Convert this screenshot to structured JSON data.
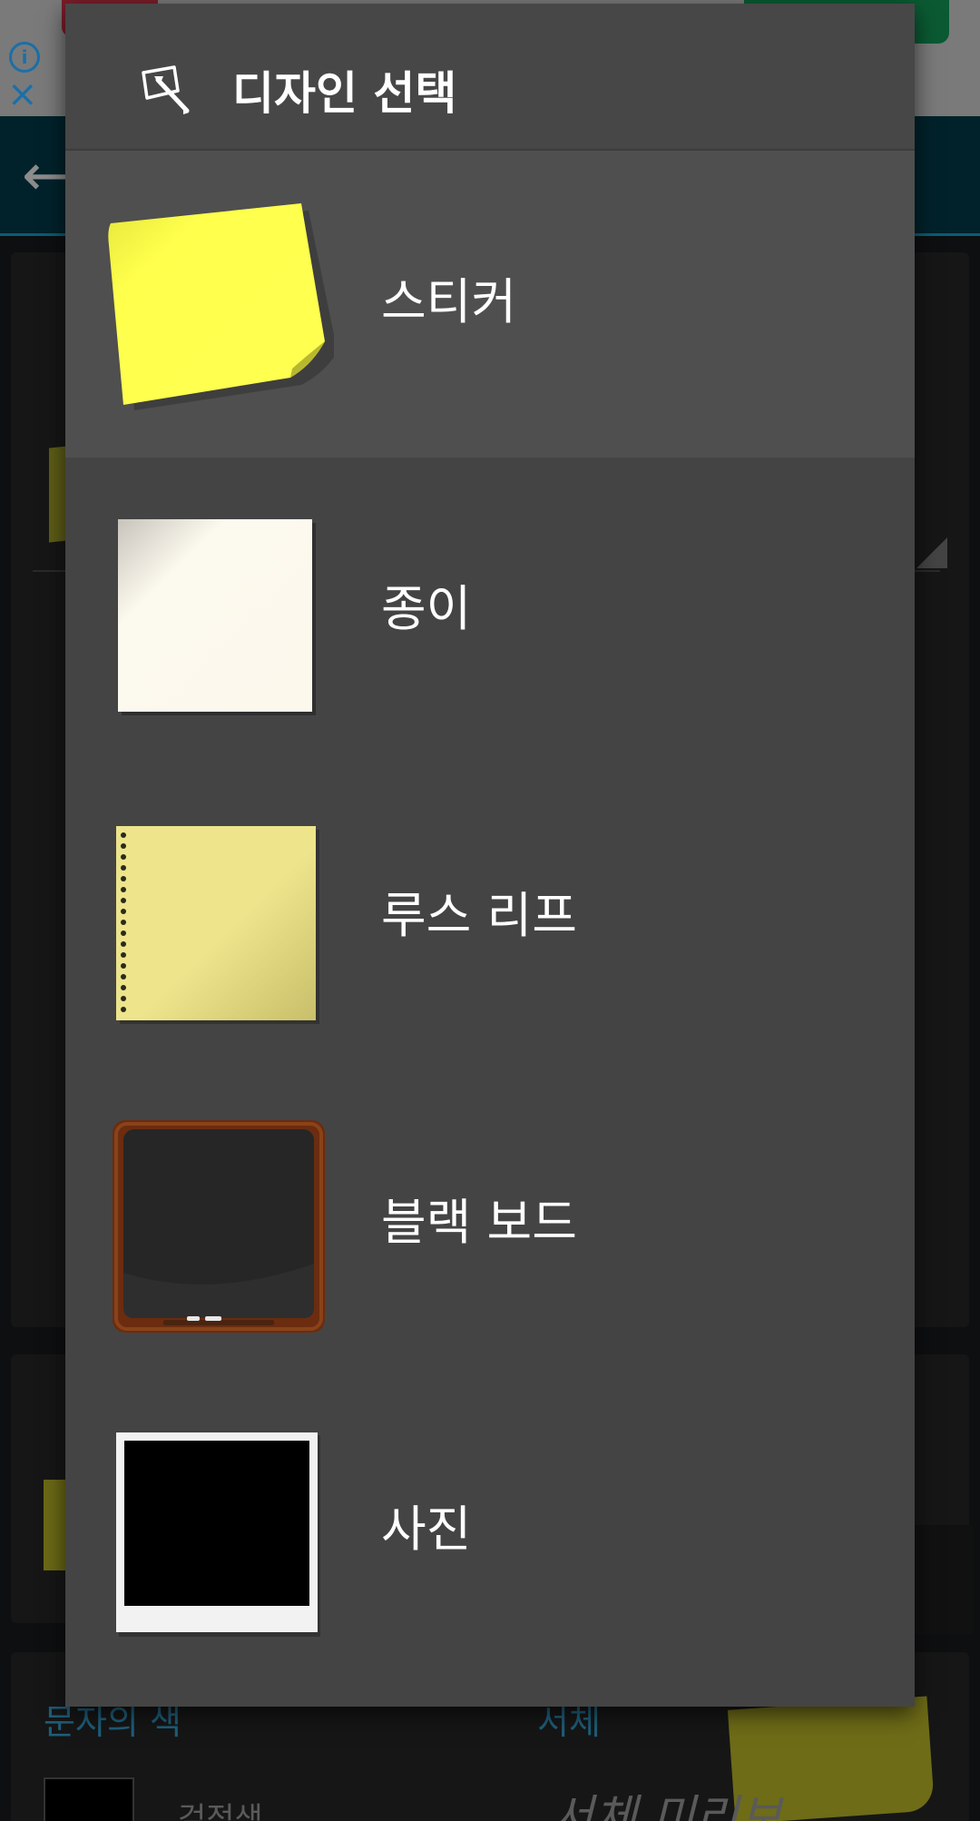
{
  "dialog": {
    "title": "디자인 선택",
    "title_icon": "design-pen-icon",
    "options": [
      {
        "label": "스티커",
        "icon": "sticker-note-thumbnail",
        "selected": true
      },
      {
        "label": "종이",
        "icon": "paper-thumbnail",
        "selected": false
      },
      {
        "label": "루스 리프",
        "icon": "loose-leaf-thumbnail",
        "selected": false
      },
      {
        "label": "블랙 보드",
        "icon": "blackboard-thumbnail",
        "selected": false
      },
      {
        "label": "사진",
        "icon": "photo-frame-thumbnail",
        "selected": false
      }
    ]
  },
  "background": {
    "text_color_label": "문자의 색",
    "font_label": "서체",
    "color_value_partial": "검정색",
    "font_preview_partial": "서체 미리보"
  },
  "colors": {
    "dialog_bg": "#444444",
    "selected_row_bg": "#4f4f4f",
    "header_bg": "#474747",
    "text": "#ffffff",
    "sticker_yellow": "#ffff4c",
    "paper_cream": "#fcf9ee",
    "loose_leaf_yellow": "#ede48c",
    "blackboard_frame": "#6b2c10"
  }
}
